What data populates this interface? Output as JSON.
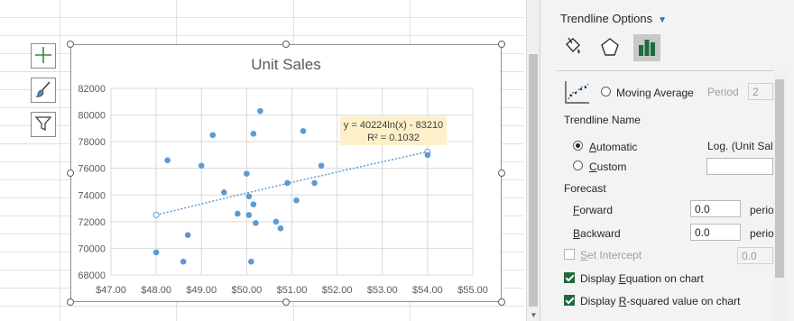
{
  "chart": {
    "title": "Unit Sales",
    "trendline_equation": "y = 40224ln(x) - 83210",
    "trendline_r2": "R² = 0.1032",
    "colors": {
      "points": "#5b9bd5",
      "trendline": "#5b9bd5",
      "label_bg": "#fdf0c8"
    }
  },
  "chart_data": {
    "type": "scatter",
    "title": "Unit Sales",
    "xlim": [
      47,
      55
    ],
    "ylim": [
      68000,
      82000
    ],
    "x_ticks": [
      "$47.00",
      "$48.00",
      "$49.00",
      "$50.00",
      "$51.00",
      "$52.00",
      "$53.00",
      "$54.00",
      "$55.00"
    ],
    "y_ticks": [
      "68000",
      "70000",
      "72000",
      "74000",
      "76000",
      "78000",
      "80000",
      "82000"
    ],
    "points": [
      [
        48.0,
        69700
      ],
      [
        48.25,
        76600
      ],
      [
        48.6,
        69000
      ],
      [
        48.7,
        71000
      ],
      [
        49.0,
        76200
      ],
      [
        49.25,
        78500
      ],
      [
        49.5,
        74200
      ],
      [
        49.8,
        72600
      ],
      [
        50.0,
        75600
      ],
      [
        50.05,
        72500
      ],
      [
        50.05,
        73900
      ],
      [
        50.1,
        69000
      ],
      [
        50.15,
        78600
      ],
      [
        50.15,
        73300
      ],
      [
        50.2,
        71900
      ],
      [
        50.3,
        80300
      ],
      [
        50.65,
        72000
      ],
      [
        50.75,
        71500
      ],
      [
        50.9,
        74900
      ],
      [
        51.1,
        73600
      ],
      [
        51.25,
        78800
      ],
      [
        51.5,
        74900
      ],
      [
        51.65,
        76200
      ],
      [
        54.0,
        77000
      ]
    ],
    "trendline": {
      "type": "logarithmic",
      "equation": "y = 40224ln(x) - 83210",
      "r_squared": 0.1032
    },
    "grid": true,
    "legend": "none"
  },
  "side_buttons": [
    {
      "name": "chart-elements-button",
      "icon": "plus-icon"
    },
    {
      "name": "chart-styles-button",
      "icon": "brush-icon"
    },
    {
      "name": "chart-filters-button",
      "icon": "filter-icon"
    }
  ],
  "pane": {
    "title": "Trendline Options",
    "tabs": [
      {
        "name": "fill-line-tab",
        "icon": "paint-bucket-icon"
      },
      {
        "name": "effects-tab",
        "icon": "pentagon-icon"
      },
      {
        "name": "trendline-options-tab",
        "icon": "bar-chart-icon",
        "active": true
      }
    ],
    "moving_average_label": "Moving Average",
    "period_label": "Period",
    "period_value": "2",
    "trendline_name_heading": "Trendline Name",
    "automatic_label": "Automatic",
    "automatic_value": "Log. (Unit Sale",
    "custom_label": "Custom",
    "forecast_heading": "Forecast",
    "forward_label": "Forward",
    "forward_value": "0.0",
    "forward_unit": "perio",
    "backward_label": "Backward",
    "backward_value": "0.0",
    "backward_unit": "perio",
    "set_intercept_label": "Set Intercept",
    "set_intercept_value": "0.0",
    "display_equation_label": "Display Equation on chart",
    "display_r2_label": "Display R-squared value on chart"
  }
}
